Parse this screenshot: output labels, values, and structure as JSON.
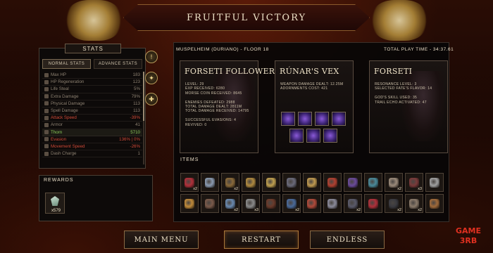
{
  "title": "FRUITFUL VICTORY",
  "stats": {
    "header": "STATS",
    "tabs": [
      "NORMAL STATS",
      "ADVANCE STATS"
    ],
    "rows": [
      {
        "label": "Max HP",
        "value": "183",
        "style": "dim"
      },
      {
        "label": "HP Regeneration",
        "value": "123",
        "style": "dim"
      },
      {
        "label": "Life Steal",
        "value": "5%",
        "style": "dim"
      },
      {
        "label": "Extra Damage",
        "value": "79%",
        "style": "dim"
      },
      {
        "label": "Physical Damage",
        "value": "113",
        "style": "dim"
      },
      {
        "label": "Spell Damage",
        "value": "113",
        "style": "dim"
      },
      {
        "label": "Attack Speed",
        "value": "-39%",
        "style": "red"
      },
      {
        "label": "Armor",
        "value": "41",
        "style": "dim"
      },
      {
        "label": "Thorn",
        "value": "5710",
        "style": "green"
      },
      {
        "label": "Evasion",
        "value": "136% | 0%",
        "style": "red"
      },
      {
        "label": "Movement Speed",
        "value": "-26%",
        "style": "red"
      },
      {
        "label": "Dash Charge",
        "value": "1",
        "style": "dim"
      }
    ]
  },
  "rewards": {
    "title": "REWARDS",
    "count": "x579"
  },
  "summary": {
    "location": "MUSPELHEIM (DURIANO) - FLOOR 18",
    "playtime": "TOTAL PLAY TIME - 34:37.61",
    "follower": {
      "title": "FORSETI FOLLOWER",
      "lines": [
        "LEVEL: 29",
        "EXP RECEIVED: 6280",
        "MORSE COIN RECEIVED: 8645",
        "",
        "ENEMIES DEFEATED: 2988",
        "TOTAL DAMAGE DEALT: 2811M",
        "TOTAL DAMAGE RECEIVED: 14795",
        "",
        "SUCCESSFUL EVASIONS: 4",
        "REVIVED: 0"
      ]
    },
    "weapon": {
      "title": "RÚNAR'S VEX",
      "lines": [
        "WEAPON DAMAGE DEALT: 12.25M",
        "ADORNMENTS COST: 421"
      ]
    },
    "god": {
      "title": "FORSETI",
      "lines": [
        "RESONANCE LEVEL: 3",
        "SELECTED FATE'S FLAVOR: 14",
        "",
        "GOD'S SKILL USED: 35",
        "TRAIL ECHO ACTIVATED: 47"
      ]
    }
  },
  "items": {
    "title": "ITEMS",
    "slots": [
      {
        "count": "x2",
        "color": "#b0303a"
      },
      {
        "count": "",
        "color": "#8a9ab0"
      },
      {
        "count": "x2",
        "color": "#8a6a3a"
      },
      {
        "count": "",
        "color": "#b08a40"
      },
      {
        "count": "",
        "color": "#c0a050"
      },
      {
        "count": "",
        "color": "#6a6a7a"
      },
      {
        "count": "",
        "color": "#c09a50"
      },
      {
        "count": "",
        "color": "#b04030"
      },
      {
        "count": "",
        "color": "#6a4a9a"
      },
      {
        "count": "",
        "color": "#4a8a9a"
      },
      {
        "count": "x2",
        "color": "#9a8a7a"
      },
      {
        "count": "x3",
        "color": "#7a3a3a"
      },
      {
        "count": "",
        "color": "#a0a0a0"
      },
      {
        "count": "",
        "color": "#c08a3a"
      },
      {
        "count": "",
        "color": "#7a5a4a"
      },
      {
        "count": "x2",
        "color": "#6a8ab0"
      },
      {
        "count": "x3",
        "color": "#8a8a8a"
      },
      {
        "count": "",
        "color": "#6a3a2a"
      },
      {
        "count": "x2",
        "color": "#4a6a9a"
      },
      {
        "count": "",
        "color": "#b04a3a"
      },
      {
        "count": "",
        "color": "#8a8a9a"
      },
      {
        "count": "x2",
        "color": "#5a5a6a"
      },
      {
        "count": "",
        "color": "#b0303a"
      },
      {
        "count": "x2",
        "color": "#3a3a40"
      },
      {
        "count": "x2",
        "color": "#8a7a6a"
      },
      {
        "count": "",
        "color": "#a06a3a"
      }
    ]
  },
  "buttons": {
    "main_menu": "MAIN MENU",
    "restart": "RESTART",
    "endless": "ENDLESS"
  },
  "watermark": {
    "line1": "GAME",
    "line2": "3RB"
  }
}
